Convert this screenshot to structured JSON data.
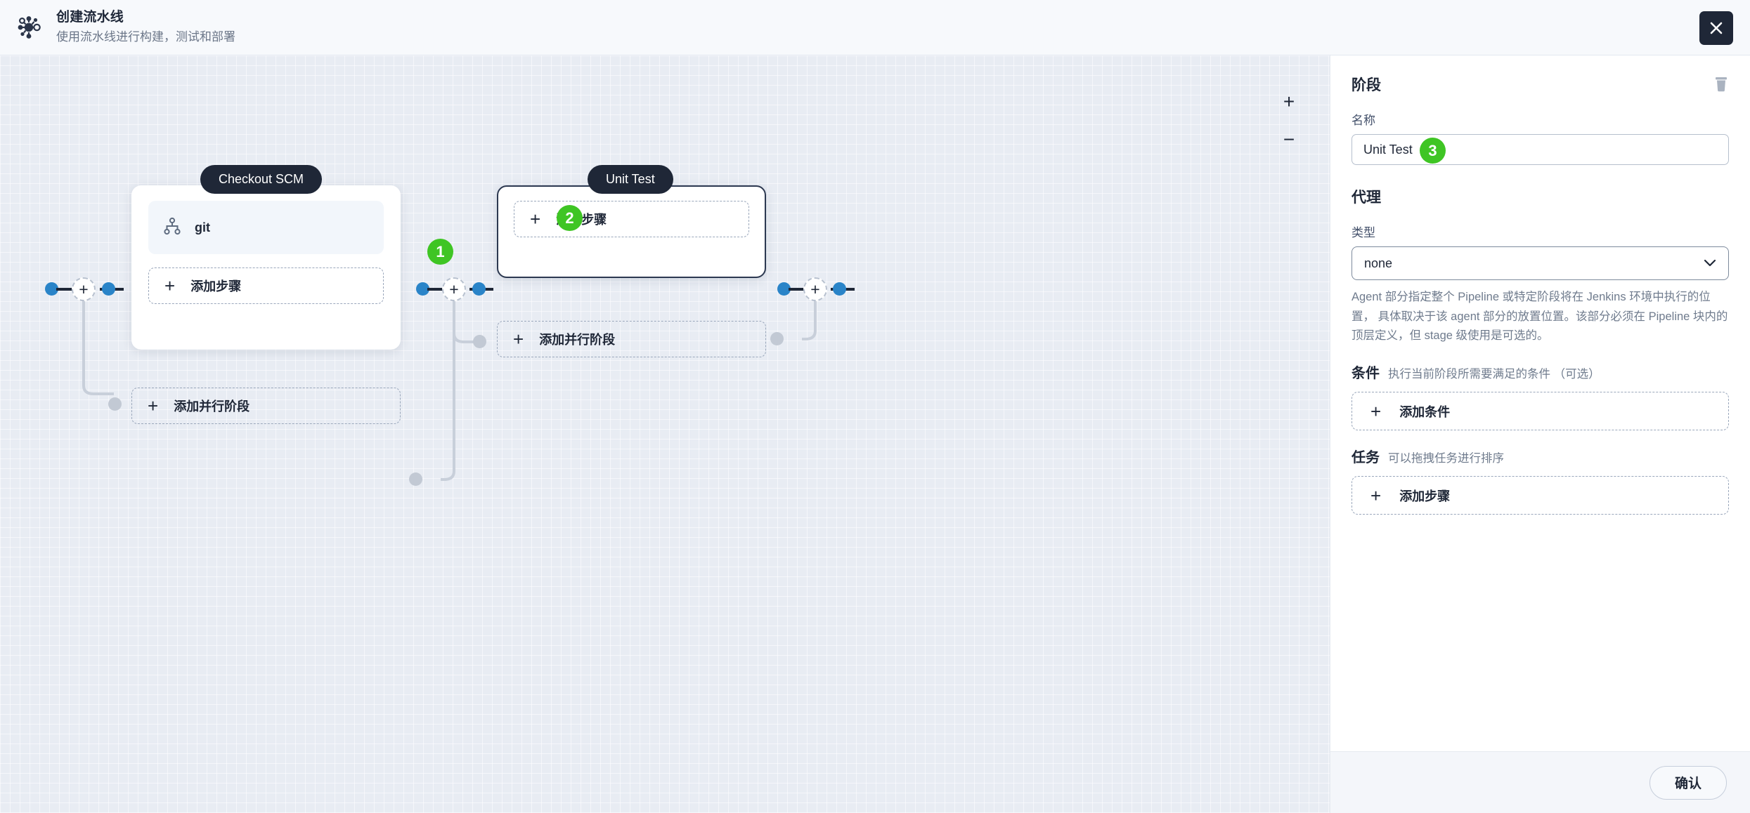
{
  "header": {
    "logo_icon": "pipeline-node-icon",
    "title": "创建流水线",
    "subtitle": "使用流水线进行构建，测试和部署",
    "close_icon": "close-icon"
  },
  "canvas": {
    "zoom_in": "+",
    "zoom_out": "−",
    "badges": [
      {
        "id": "1",
        "text": "1"
      },
      {
        "id": "2",
        "text": "2"
      }
    ],
    "stages": [
      {
        "label": "Checkout SCM",
        "selected": false,
        "steps": [
          {
            "icon": "git-branch-icon",
            "name": "git"
          }
        ],
        "add_step_label": "添加步骤",
        "add_parallel_label": "添加并行阶段"
      },
      {
        "label": "Unit Test",
        "selected": true,
        "steps": [],
        "add_step_label": "添加步骤",
        "add_parallel_label": "添加并行阶段"
      }
    ],
    "plus_node_glyph": "+"
  },
  "panel": {
    "title": "阶段",
    "delete_icon": "trash-icon",
    "name_label": "名称",
    "name_value": "Unit Test",
    "name_badge": "3",
    "agent_section_title": "代理",
    "type_label": "类型",
    "type_value": "none",
    "type_chevron_icon": "chevron-down-icon",
    "agent_help": "Agent 部分指定整个 Pipeline 或特定阶段将在 Jenkins 环境中执行的位置， 具体取决于该 agent 部分的放置位置。该部分必须在 Pipeline 块内的顶层定义，但 stage 级使用是可选的。",
    "condition_title": "条件",
    "condition_hint": "执行当前阶段所需要满足的条件 （可选）",
    "add_condition_label": "添加条件",
    "task_title": "任务",
    "task_hint": "可以拖拽任务进行排序",
    "add_step_label": "添加步骤",
    "confirm_label": "确认"
  },
  "colors": {
    "accent_green": "#3fc524",
    "node_blue": "#2a84c8",
    "dark": "#1f2737",
    "canvas_bg": "#e8ecf3"
  }
}
